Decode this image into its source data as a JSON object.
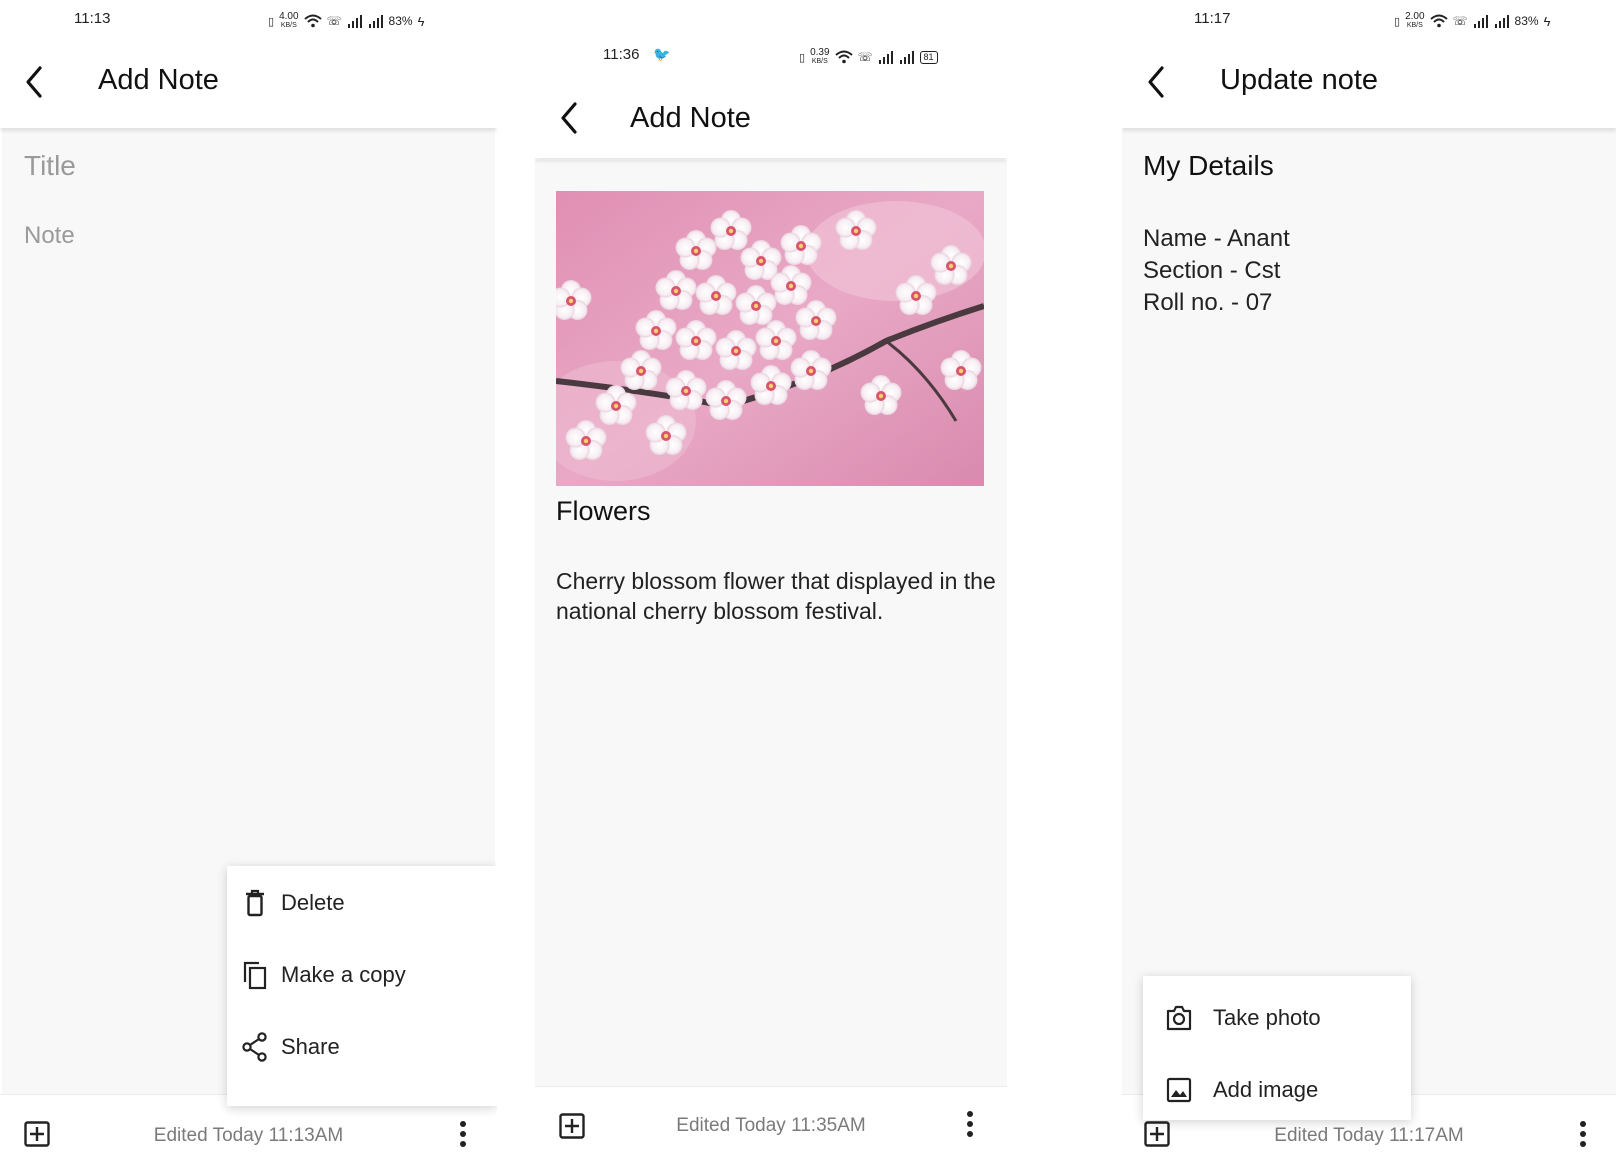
{
  "screen1": {
    "status": {
      "time": "11:13",
      "speed": "4.00",
      "speed_unit": "KB/S",
      "battery": "83%"
    },
    "header": {
      "title": "Add Note"
    },
    "fields": {
      "title_placeholder": "Title",
      "note_placeholder": "Note"
    },
    "menu": [
      {
        "label": "Delete",
        "icon": "trash-icon"
      },
      {
        "label": "Make a copy",
        "icon": "copy-icon"
      },
      {
        "label": "Share",
        "icon": "share-icon"
      }
    ],
    "footer": {
      "edited": "Edited Today 11:13AM"
    }
  },
  "screen2": {
    "status": {
      "time": "11:36",
      "speed": "0.39",
      "speed_unit": "KB/S",
      "battery": "81"
    },
    "header": {
      "title": "Add Note"
    },
    "note": {
      "title": "Flowers",
      "text": "Cherry blossom flower that displayed in the national cherry blossom festival."
    },
    "footer": {
      "edited": "Edited Today 11:35AM"
    }
  },
  "screen3": {
    "status": {
      "time": "11:17",
      "speed": "2.00",
      "speed_unit": "KB/S",
      "battery": "83%"
    },
    "header": {
      "title": "Update note"
    },
    "note": {
      "title": "My Details",
      "lines": [
        "Name - Anant",
        "Section - Cst",
        "Roll no. - 07"
      ]
    },
    "menu": [
      {
        "label": "Take photo",
        "icon": "camera-icon"
      },
      {
        "label": "Add image",
        "icon": "image-icon"
      }
    ],
    "footer": {
      "edited": "Edited Today 11:17AM"
    }
  },
  "colors": {
    "background": "#f8f8f8",
    "text": "#1f1f1f",
    "muted": "#7a7a7a",
    "blossom_pink": "#e7a3c1"
  }
}
